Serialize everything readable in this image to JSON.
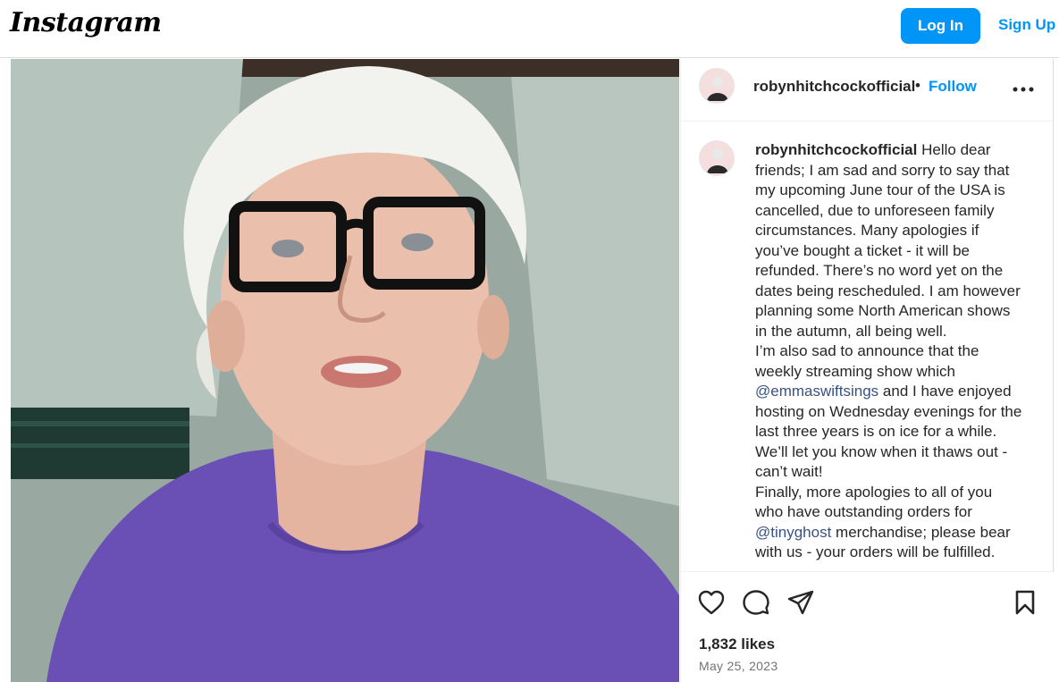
{
  "header": {
    "logo_text": "Instagram",
    "login_label": "Log In",
    "signup_label": "Sign Up"
  },
  "post": {
    "username": "robynhitchcockofficial",
    "separator": "•",
    "follow_label": "Follow",
    "caption": {
      "paragraph_1": "Hello dear friends; I am sad and sorry to say that my upcoming June tour of the USA is cancelled, due to unforeseen family circumstances. Many apologies if you’ve bought a ticket - it will be refunded. There’s no word yet on the dates being rescheduled. I am however planning some North American shows in the autumn, all being well.",
      "paragraph_2_before": "I’m also sad to announce that the weekly streaming show which",
      "mention_1": "@emmaswiftsings",
      "paragraph_2_after": "and I have enjoyed hosting on Wednesday evenings for the last three years is on ice for a while. We’ll let you know when it thaws out - can’t wait!",
      "paragraph_3_before": "Finally, more apologies to all of you who have outstanding orders for",
      "mention_2": "@tinyghost",
      "paragraph_3_after": "merchandise; please bear with us - your orders will be fulfilled."
    },
    "likes": "1,832 likes",
    "date": "May 25, 2023"
  },
  "icons": {
    "more": "more-options-icon",
    "like": "heart-icon",
    "comment": "comment-icon",
    "share": "share-icon",
    "save": "bookmark-icon"
  },
  "colors": {
    "accent": "#0095f6",
    "mention": "#385185",
    "shirt": "#6a4fb5"
  }
}
